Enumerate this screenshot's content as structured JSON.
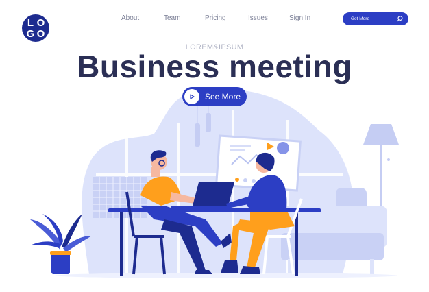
{
  "logo": {
    "letters": [
      "L",
      "O",
      "G",
      "O"
    ]
  },
  "nav": {
    "items": [
      "About",
      "Team",
      "Pricing",
      "Issues",
      "Sign In"
    ]
  },
  "header": {
    "cta_label": "Get More",
    "cta_icon": "search-icon"
  },
  "hero": {
    "eyebrow": "LOREM&IPSUM",
    "title": "Business meeting",
    "button_label": "See More",
    "button_icon": "play-icon"
  },
  "colors": {
    "brand": "#2c3ec4",
    "logo": "#1d2b8f",
    "title": "#2b2f55",
    "nav_text": "#7b7f96",
    "background_shape": "#dde3fb",
    "accent_orange": "#ff9f1c"
  }
}
